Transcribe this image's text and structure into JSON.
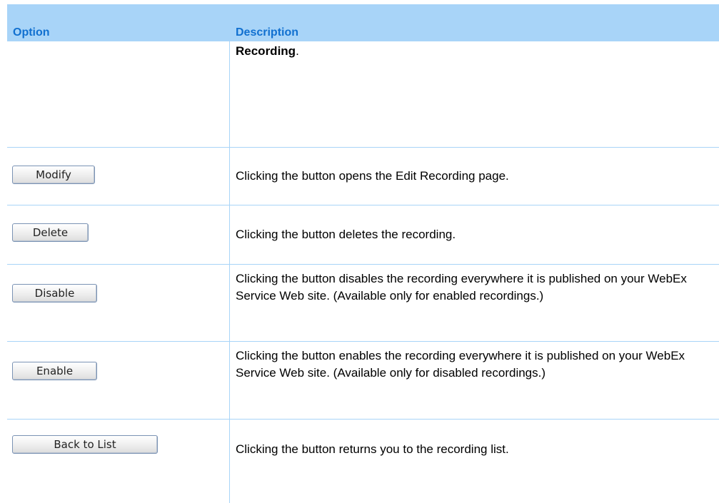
{
  "table": {
    "headers": {
      "option": "Option",
      "description": "Description"
    },
    "first_row": {
      "desc_bold": "Recording",
      "desc_suffix": "."
    },
    "rows": [
      {
        "button": "Modify",
        "description": "Clicking the button opens the Edit Recording page."
      },
      {
        "button": "Delete",
        "description": "Clicking the button deletes the recording."
      },
      {
        "button": "Disable",
        "description": "Clicking the button disables the recording everywhere it is published on your WebEx Service Web site. (Available only for enabled recordings.)"
      },
      {
        "button": "Enable",
        "description": "Clicking the button enables the recording everywhere it is published on your WebEx Service Web site. (Available only for disabled recordings.)"
      },
      {
        "button": "Back to List",
        "description": "Clicking the button returns you to the recording list."
      }
    ]
  }
}
